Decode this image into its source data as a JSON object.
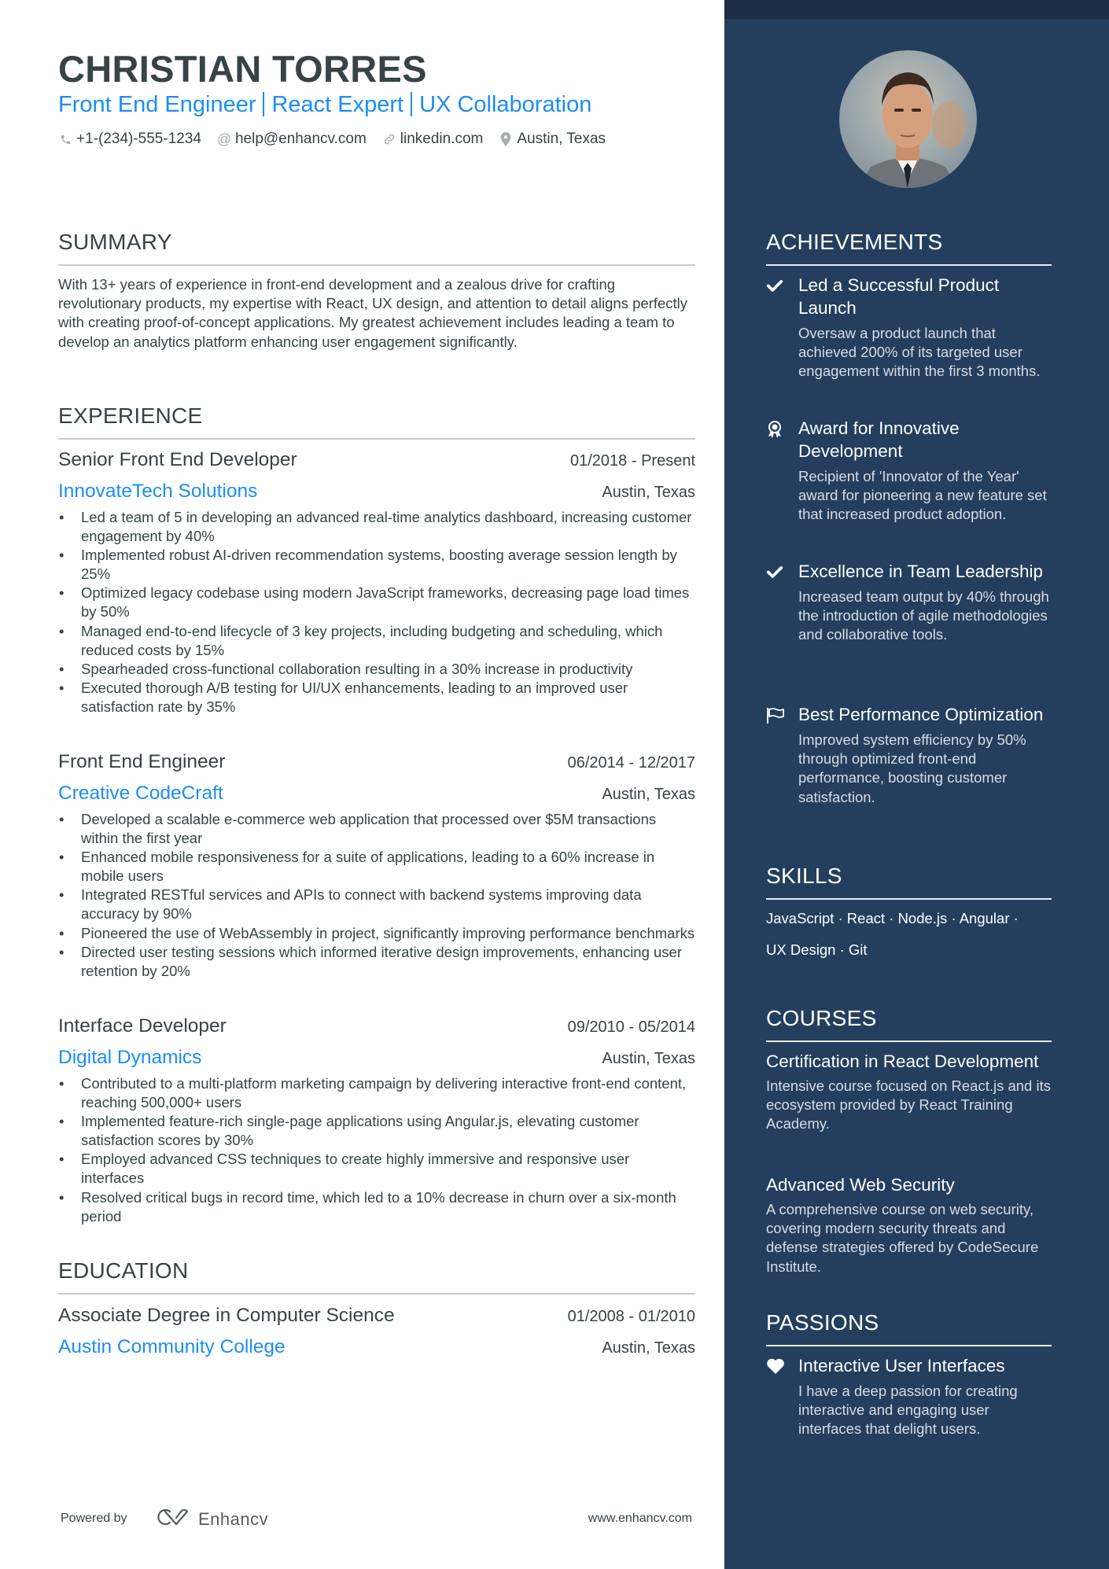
{
  "header": {
    "name": "CHRISTIAN TORRES",
    "tagline": [
      "Front End Engineer",
      "React Expert",
      "UX Collaboration"
    ],
    "contacts": [
      {
        "icon": "phone-icon",
        "text": "+1-(234)-555-1234"
      },
      {
        "icon": "at-icon",
        "text": "help@enhancv.com"
      },
      {
        "icon": "link-icon",
        "text": "linkedin.com"
      },
      {
        "icon": "location-icon",
        "text": "Austin, Texas"
      }
    ]
  },
  "summary": {
    "title": "SUMMARY",
    "text": "With 13+ years of experience in front-end development and a zealous drive for crafting revolutionary products, my expertise with React, UX design, and attention to detail aligns perfectly with creating proof-of-concept applications. My greatest achievement includes leading a team to develop an analytics platform enhancing user engagement significantly."
  },
  "experience": {
    "title": "EXPERIENCE",
    "jobs": [
      {
        "title": "Senior Front End Developer",
        "dates": "01/2018 - Present",
        "company": "InnovateTech Solutions",
        "location": "Austin, Texas",
        "bullets": [
          "Led a team of 5 in developing an advanced real-time analytics dashboard, increasing customer engagement by 40%",
          "Implemented robust AI-driven recommendation systems, boosting average session length by 25%",
          "Optimized legacy codebase using modern JavaScript frameworks, decreasing page load times by 50%",
          "Managed end-to-end lifecycle of 3 key projects, including budgeting and scheduling, which reduced costs by 15%",
          "Spearheaded cross-functional collaboration resulting in a 30% increase in productivity",
          "Executed thorough A/B testing for UI/UX enhancements, leading to an improved user satisfaction rate by 35%"
        ]
      },
      {
        "title": "Front End Engineer",
        "dates": "06/2014 - 12/2017",
        "company": "Creative CodeCraft",
        "location": "Austin, Texas",
        "bullets": [
          "Developed a scalable e-commerce web application that processed over $5M transactions within the first year",
          "Enhanced mobile responsiveness for a suite of applications, leading to a 60% increase in mobile users",
          "Integrated RESTful services and APIs to connect with backend systems improving data accuracy by 90%",
          "Pioneered the use of WebAssembly in project, significantly improving performance benchmarks",
          "Directed user testing sessions which informed iterative design improvements, enhancing user retention by 20%"
        ]
      },
      {
        "title": "Interface Developer",
        "dates": "09/2010 - 05/2014",
        "company": "Digital Dynamics",
        "location": "Austin, Texas",
        "bullets": [
          "Contributed to a multi-platform marketing campaign by delivering interactive front-end content, reaching 500,000+ users",
          "Implemented feature-rich single-page applications using Angular.js, elevating customer satisfaction scores by 30%",
          "Employed advanced CSS techniques to create highly immersive and responsive user interfaces",
          "Resolved critical bugs in record time, which led to a 10% decrease in churn over a six-month period"
        ]
      }
    ]
  },
  "education": {
    "title": "EDUCATION",
    "degree": "Associate Degree in Computer Science",
    "dates": "01/2008 - 01/2010",
    "school": "Austin Community College",
    "location": "Austin, Texas"
  },
  "footer": {
    "powered_by": "Powered by",
    "brand": "Enhancv",
    "website": "www.enhancv.com"
  },
  "achievements": {
    "title": "ACHIEVEMENTS",
    "items": [
      {
        "icon": "checkmark-icon",
        "title": "Led a Successful Product Launch",
        "desc": "Oversaw a product launch that achieved 200% of its targeted user engagement within the first 3 months."
      },
      {
        "icon": "award-ribbon-icon",
        "title": "Award for Innovative Development",
        "desc": "Recipient of 'Innovator of the Year' award for pioneering a new feature set that increased product adoption."
      },
      {
        "icon": "checkmark-icon",
        "title": "Excellence in Team Leadership",
        "desc": "Increased team output by 40% through the introduction of agile methodologies and collaborative tools."
      },
      {
        "icon": "flag-icon",
        "title": "Best Performance Optimization",
        "desc": "Improved system efficiency by 50% through optimized front-end performance, boosting customer satisfaction."
      }
    ]
  },
  "skills": {
    "title": "SKILLS",
    "line1": "JavaScript · React · Node.js · Angular ·",
    "line2": "UX Design · Git",
    "items": [
      "JavaScript",
      "React",
      "Node.js",
      "Angular",
      "UX Design",
      "Git"
    ]
  },
  "courses": {
    "title": "COURSES",
    "items": [
      {
        "title": "Certification in React Development",
        "desc": "Intensive course focused on React.js and its ecosystem provided by React Training Academy."
      },
      {
        "title": "Advanced Web Security",
        "desc": "A comprehensive course on web security, covering modern security threats and defense strategies offered by CodeSecure Institute."
      }
    ]
  },
  "passions": {
    "title": "PASSIONS",
    "items": [
      {
        "icon": "heart-icon",
        "title": "Interactive User Interfaces",
        "desc": "I have a deep passion for creating interactive and engaging user interfaces that delight users."
      }
    ]
  },
  "colors": {
    "accent": "#1b8ef2",
    "text": "#384347",
    "sidebar": "#243f5e",
    "sidebar_top": "#1b2d44"
  }
}
